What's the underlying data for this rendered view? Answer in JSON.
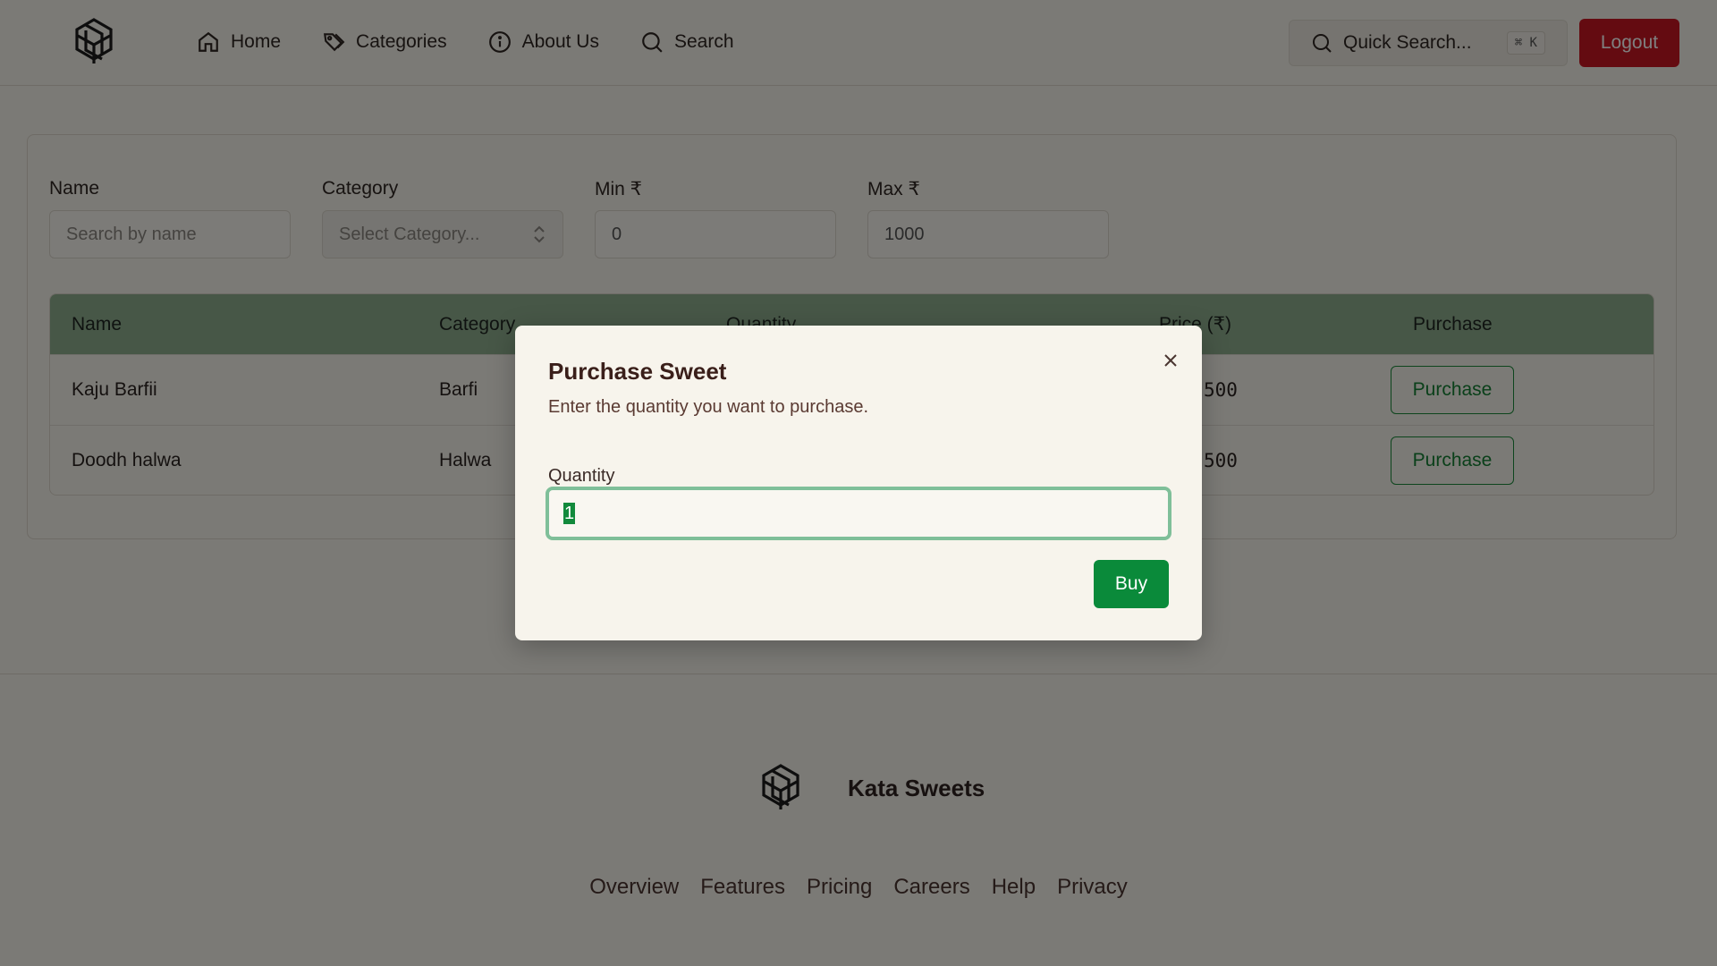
{
  "nav": {
    "items": [
      {
        "label": "Home",
        "icon": "home-icon"
      },
      {
        "label": "Categories",
        "icon": "tags-icon"
      },
      {
        "label": "About Us",
        "icon": "info-icon"
      },
      {
        "label": "Search",
        "icon": "search-icon"
      }
    ],
    "quick_search": "Quick Search...",
    "shortcut": "⌘ K",
    "logout": "Logout"
  },
  "filters": {
    "name_label": "Name",
    "name_placeholder": "Search by name",
    "category_label": "Category",
    "category_placeholder": "Select Category...",
    "min_label": "Min ₹",
    "min_value": "0",
    "max_label": "Max ₹",
    "max_value": "1000"
  },
  "table": {
    "headers": [
      "Name",
      "Category",
      "Quantity",
      "Price (₹)",
      "Purchase"
    ],
    "rows": [
      {
        "name": "Kaju Barfii",
        "category": "Barfi",
        "price_fragment": "500",
        "action": "Purchase"
      },
      {
        "name": "Doodh halwa",
        "category": "Halwa",
        "price_fragment": "500",
        "action": "Purchase"
      }
    ]
  },
  "modal": {
    "title": "Purchase Sweet",
    "description": "Enter the quantity you want to purchase.",
    "quantity_label": "Quantity",
    "quantity_value": "1",
    "buy_label": "Buy"
  },
  "footer": {
    "brand": "Kata Sweets",
    "links": [
      "Overview",
      "Features",
      "Pricing",
      "Careers",
      "Help",
      "Privacy"
    ]
  },
  "colors": {
    "logout": "#c81622",
    "table_header": "#8faf8f",
    "buy": "#0a8a3a",
    "purchase_outline": "#1a8a3a"
  }
}
